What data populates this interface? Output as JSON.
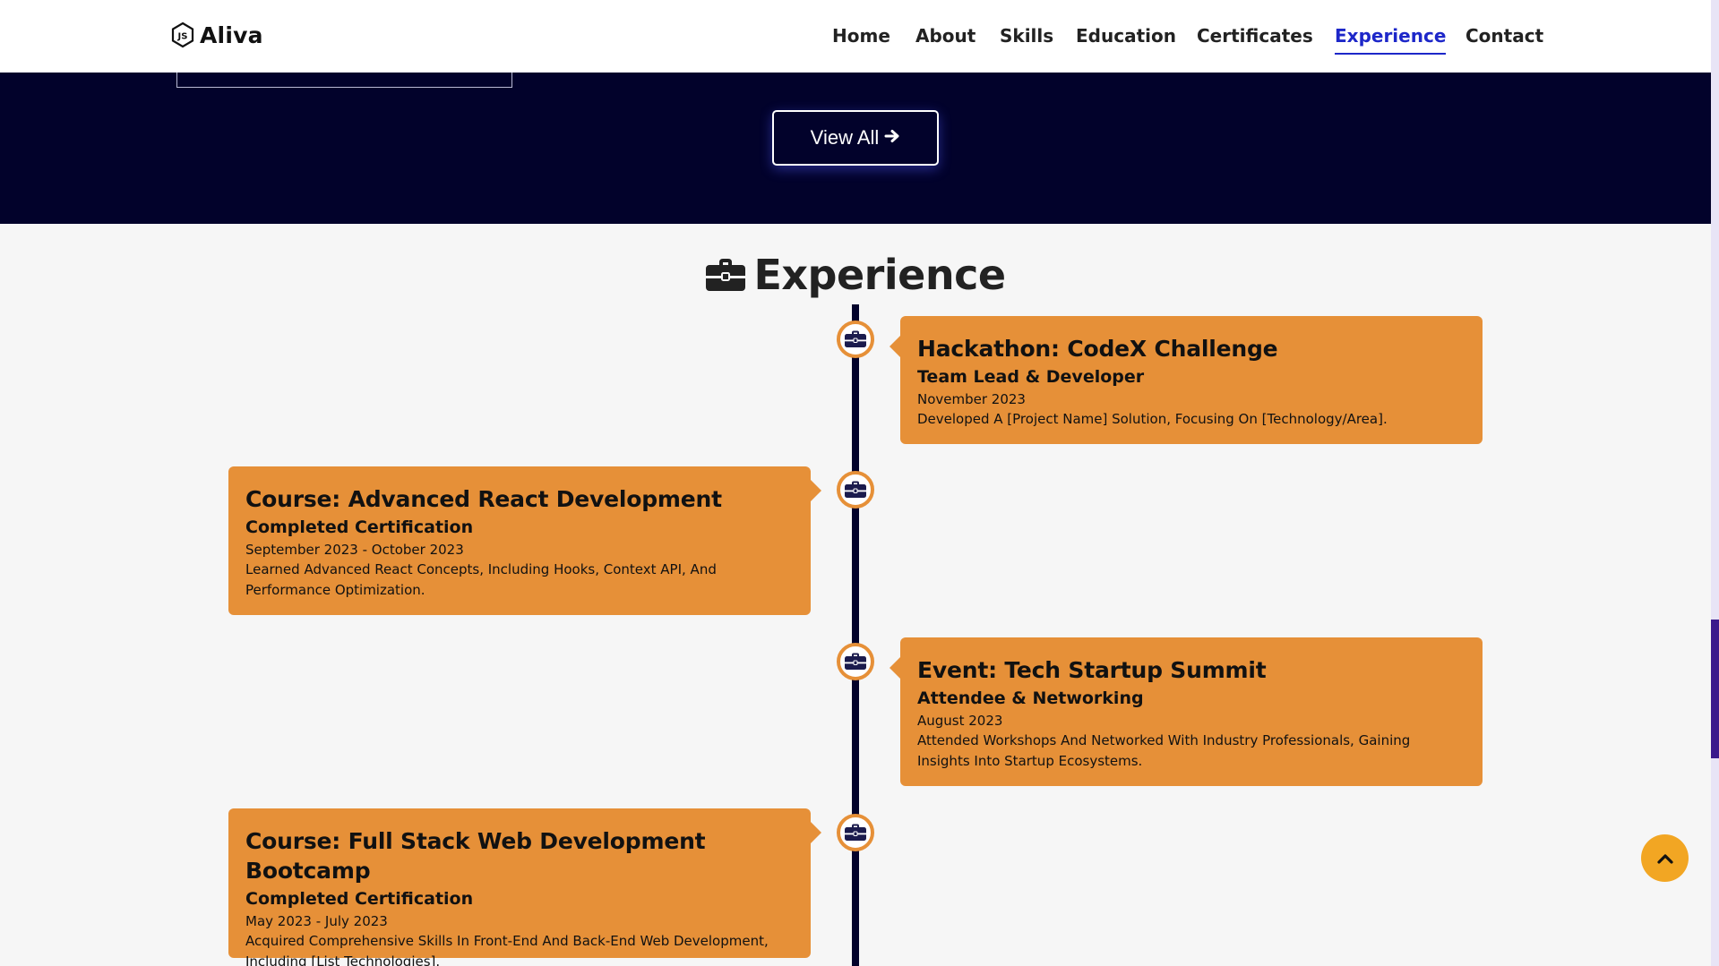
{
  "header": {
    "logo_text": "Aliva",
    "logo_icon": "nodejs-icon",
    "nav": [
      {
        "label": "Home",
        "active": false
      },
      {
        "label": "About",
        "active": false
      },
      {
        "label": "Skills",
        "active": false
      },
      {
        "label": "Education",
        "active": false
      },
      {
        "label": "Certificates",
        "active": false
      },
      {
        "label": "Experience",
        "active": true
      },
      {
        "label": "Contact",
        "active": false
      }
    ],
    "active_color": "#1d27c9"
  },
  "certificates": {
    "view_all_label": "View All",
    "view_all_icon": "arrow-right-icon",
    "band_color": "#02022b"
  },
  "experience": {
    "title": "Experience",
    "title_icon": "briefcase-icon",
    "card_color": "#e69038",
    "items": [
      {
        "side": "right",
        "title": "Hackathon: CodeX Challenge",
        "role": "Team Lead & Developer",
        "date": "November 2023",
        "description": "Developed A [Project Name] Solution, Focusing On [Technology/Area]."
      },
      {
        "side": "left",
        "title": "Course: Advanced React Development",
        "role": "Completed Certification",
        "date": "September 2023 - October 2023",
        "description": "Learned Advanced React Concepts, Including Hooks, Context API, And Performance Optimization."
      },
      {
        "side": "right",
        "title": "Event: Tech Startup Summit",
        "role": "Attendee & Networking",
        "date": "August 2023",
        "description": "Attended Workshops And Networked With Industry Professionals, Gaining Insights Into Startup Ecosystems."
      },
      {
        "side": "left",
        "title": "Course: Full Stack Web Development Bootcamp",
        "role": "Completed Certification",
        "date": "May 2023 - July 2023",
        "description": "Acquired Comprehensive Skills In Front-End And Back-End Web Development, Including [List Technologies]."
      }
    ]
  },
  "scroll_top": {
    "icon": "chevron-up-icon",
    "color": "#f2a623"
  }
}
